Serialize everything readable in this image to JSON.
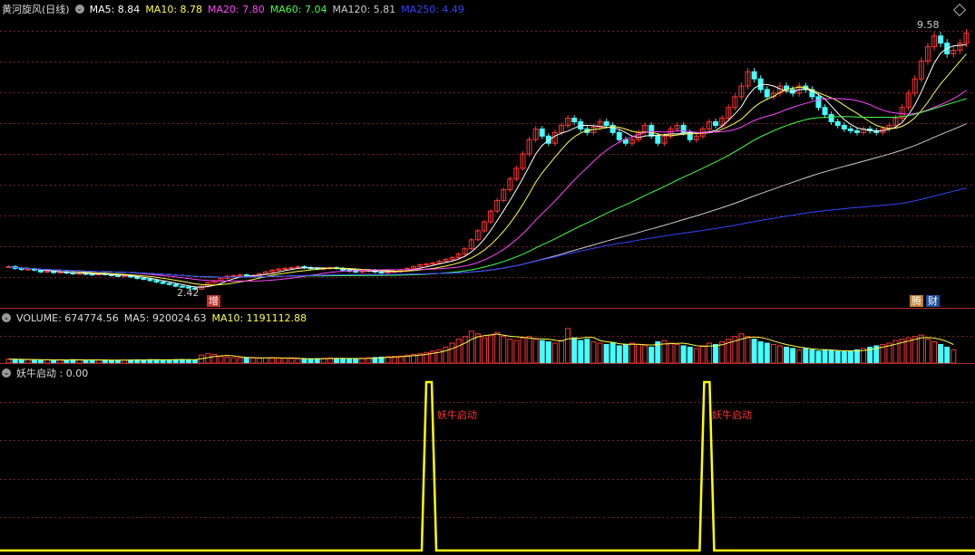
{
  "price_pane": {
    "title": "黄河旋风(日线)",
    "ma_legend": [
      {
        "label": "MA5: 8.84",
        "color": "#ffffff"
      },
      {
        "label": "MA10: 8.78",
        "color": "#ffff44"
      },
      {
        "label": "MA20: 7.80",
        "color": "#ff44ff"
      },
      {
        "label": "MA60: 7.04",
        "color": "#44ff44"
      },
      {
        "label": "MA120: 5.81",
        "color": "#cccccc"
      },
      {
        "label": "MA250: 4.49",
        "color": "#3344ff"
      }
    ],
    "high_label": "9.58",
    "low_label": "2.42",
    "tag_zeng": "增",
    "tag_teng": "腾",
    "tag_cai": "财",
    "up_color": "#ff3333",
    "down_color": "#44ffff"
  },
  "volume_pane": {
    "legend": [
      {
        "label": "VOLUME: 674774.56",
        "color": "#dddddd"
      },
      {
        "label": "MA5: 920024.63",
        "color": "#dddddd"
      },
      {
        "label": "MA10: 1191112.88",
        "color": "#ffff44"
      }
    ]
  },
  "indicator_pane": {
    "legend": [
      {
        "label": "妖牛启动 : 0.00",
        "color": "#dddddd"
      }
    ],
    "signal_label_1": "妖牛启动",
    "signal_label_2": "妖牛启动",
    "signal_color": "#ffff00",
    "label_color": "#ff3333"
  },
  "chart_data": {
    "type": "candlestick",
    "price_range": [
      2.2,
      10.0
    ],
    "closes": [
      3.05,
      3.0,
      2.97,
      2.98,
      2.95,
      2.9,
      2.92,
      2.88,
      2.9,
      2.87,
      2.85,
      2.86,
      2.84,
      2.82,
      2.85,
      2.83,
      2.8,
      2.78,
      2.8,
      2.76,
      2.72,
      2.7,
      2.66,
      2.62,
      2.58,
      2.55,
      2.5,
      2.48,
      2.45,
      2.42,
      2.5,
      2.6,
      2.65,
      2.72,
      2.78,
      2.8,
      2.82,
      2.78,
      2.8,
      2.85,
      2.9,
      2.95,
      2.98,
      3.0,
      3.02,
      3.05,
      3.02,
      3.0,
      2.98,
      3.0,
      3.02,
      3.0,
      2.95,
      2.92,
      2.9,
      2.92,
      2.95,
      2.9,
      2.88,
      2.9,
      2.92,
      2.95,
      3.0,
      3.05,
      3.1,
      3.12,
      3.15,
      3.2,
      3.25,
      3.3,
      3.4,
      3.55,
      3.8,
      4.05,
      4.3,
      4.6,
      4.9,
      5.2,
      5.5,
      5.8,
      6.2,
      6.6,
      6.9,
      6.7,
      6.5,
      6.8,
      7.0,
      7.2,
      7.1,
      6.9,
      6.8,
      6.95,
      7.1,
      7.0,
      6.8,
      6.6,
      6.5,
      6.6,
      6.8,
      7.0,
      6.7,
      6.5,
      6.7,
      6.9,
      7.0,
      6.8,
      6.6,
      6.7,
      6.9,
      7.1,
      7.0,
      7.2,
      7.5,
      7.8,
      8.1,
      8.5,
      8.3,
      8.0,
      7.8,
      7.9,
      8.1,
      8.0,
      7.9,
      8.1,
      8.0,
      7.8,
      7.5,
      7.3,
      7.1,
      7.0,
      6.9,
      6.85,
      6.8,
      6.9,
      6.85,
      6.8,
      6.9,
      7.0,
      7.2,
      7.5,
      7.9,
      8.3,
      8.8,
      9.2,
      9.5,
      9.3,
      9.0,
      9.1,
      9.3,
      9.58
    ],
    "volume_range": [
      0,
      3000000
    ],
    "volumes": [
      300000,
      280000,
      260000,
      250000,
      240000,
      230000,
      250000,
      240000,
      220000,
      230000,
      260000,
      250000,
      240000,
      230000,
      220000,
      230000,
      210000,
      200000,
      220000,
      230000,
      250000,
      240000,
      260000,
      250000,
      230000,
      240000,
      260000,
      270000,
      250000,
      240000,
      600000,
      700000,
      650000,
      500000,
      450000,
      400000,
      380000,
      420000,
      380000,
      360000,
      400000,
      420000,
      380000,
      360000,
      340000,
      320000,
      300000,
      320000,
      340000,
      360000,
      380000,
      350000,
      330000,
      320000,
      340000,
      360000,
      400000,
      420000,
      450000,
      480000,
      500000,
      520000,
      600000,
      650000,
      700000,
      800000,
      900000,
      1000000,
      1200000,
      1500000,
      1800000,
      2000000,
      2400000,
      2200000,
      1900000,
      2100000,
      2300000,
      2000000,
      1800000,
      1700000,
      1900000,
      2000000,
      1800000,
      1700000,
      1600000,
      1500000,
      1700000,
      2600000,
      1900000,
      1700000,
      1800000,
      1600000,
      1500000,
      1400000,
      1500000,
      1300000,
      1400000,
      1500000,
      1400000,
      1300000,
      1200000,
      1600000,
      1700000,
      1500000,
      1400000,
      1300000,
      1200000,
      1100000,
      1300000,
      1500000,
      1400000,
      1600000,
      1800000,
      2000000,
      2200000,
      2000000,
      1800000,
      1600000,
      1500000,
      1400000,
      1300000,
      1200000,
      1100000,
      1000000,
      1100000,
      1000000,
      900000,
      1000000,
      950000,
      900000,
      850000,
      900000,
      1000000,
      1100000,
      1200000,
      1300000,
      1400000,
      1500000,
      1700000,
      1800000,
      1900000,
      2000000,
      2100000,
      1800000,
      1600000,
      1400000,
      1200000,
      1000000
    ],
    "signals": [
      0.0,
      1.0,
      0.0,
      1.0,
      0.0
    ],
    "signal_positions": [
      0,
      0.44,
      0.5,
      0.725,
      1
    ],
    "series": [
      {
        "name": "MA5",
        "color": "#ffffff"
      },
      {
        "name": "MA10",
        "color": "#ffff44"
      },
      {
        "name": "MA20",
        "color": "#ff44ff"
      },
      {
        "name": "MA60",
        "color": "#44ff44"
      },
      {
        "name": "MA120",
        "color": "#cccccc"
      },
      {
        "name": "MA250",
        "color": "#3344ff"
      },
      {
        "name": "妖牛启动",
        "color": "#ffff00"
      }
    ]
  }
}
